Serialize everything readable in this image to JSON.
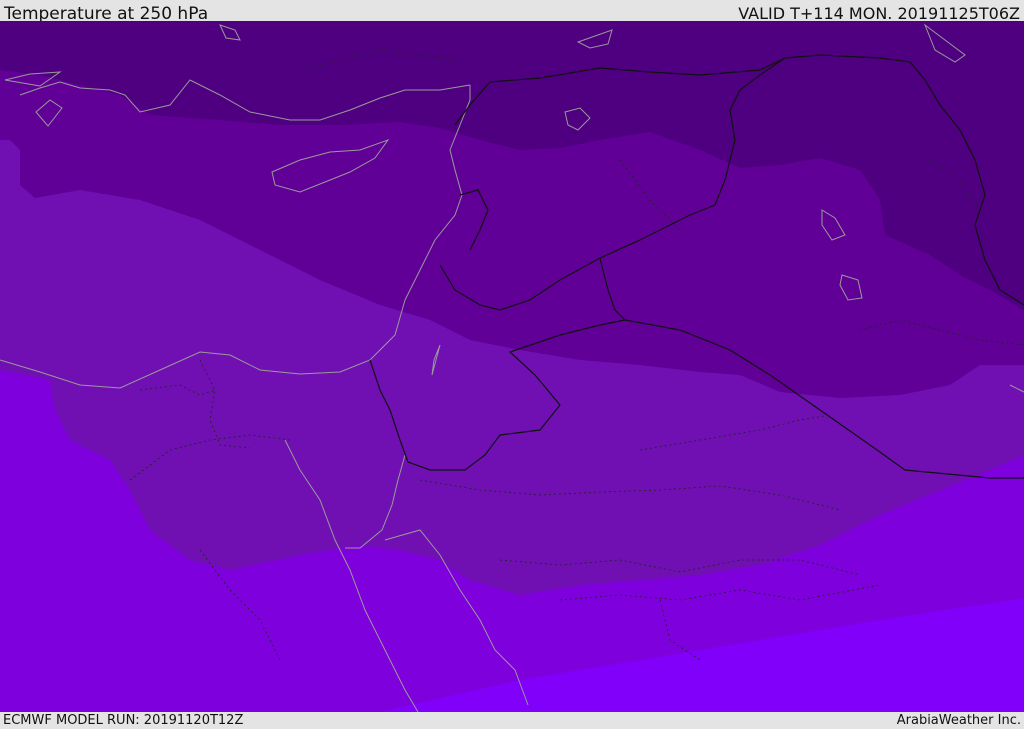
{
  "header": {
    "title": "Temperature at 250 hPa",
    "valid": "VALID T+114 MON. 20191125T06Z"
  },
  "footer": {
    "model_run": "ECMWF MODEL RUN: 20191120T12Z",
    "credit": "ArabiaWeather Inc."
  },
  "colors": {
    "band_coldest": "#4e0080",
    "band_cold": "#600096",
    "band_mid": "#7010b2",
    "band_warm": "#7e00dc",
    "band_warmest": "#8000fa",
    "coastline": "#9a9a9a",
    "border": "#111111"
  }
}
